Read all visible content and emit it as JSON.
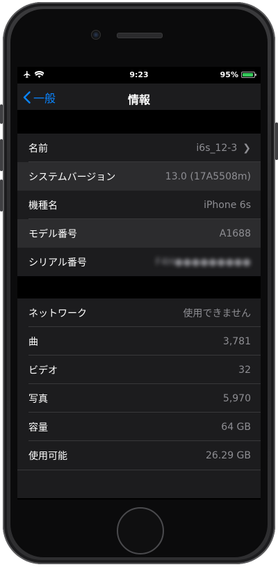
{
  "status_bar": {
    "time": "9:23",
    "battery_percent": "95%",
    "battery_level": 0.95
  },
  "nav": {
    "back_label": "一般",
    "title": "情報"
  },
  "group1": [
    {
      "label": "名前",
      "value": "i6s_12-3",
      "chevron": true
    },
    {
      "label": "システムバージョン",
      "value": "13.0 (17A5508m)"
    },
    {
      "label": "機種名",
      "value": "iPhone 6s"
    },
    {
      "label": "モデル番号",
      "value": "A1688"
    },
    {
      "label": "シリアル番号",
      "value": "F4H●●●●●●●●●"
    }
  ],
  "group2": [
    {
      "label": "ネットワーク",
      "value": "使用できません"
    },
    {
      "label": "曲",
      "value": "3,781"
    },
    {
      "label": "ビデオ",
      "value": "32"
    },
    {
      "label": "写真",
      "value": "5,970"
    },
    {
      "label": "容量",
      "value": "64 GB"
    },
    {
      "label": "使用可能",
      "value": "26.29 GB"
    }
  ],
  "colors": {
    "accent": "#0a84ff",
    "background": "#000000",
    "cell": "#1c1c1e",
    "battery": "#34c759"
  }
}
